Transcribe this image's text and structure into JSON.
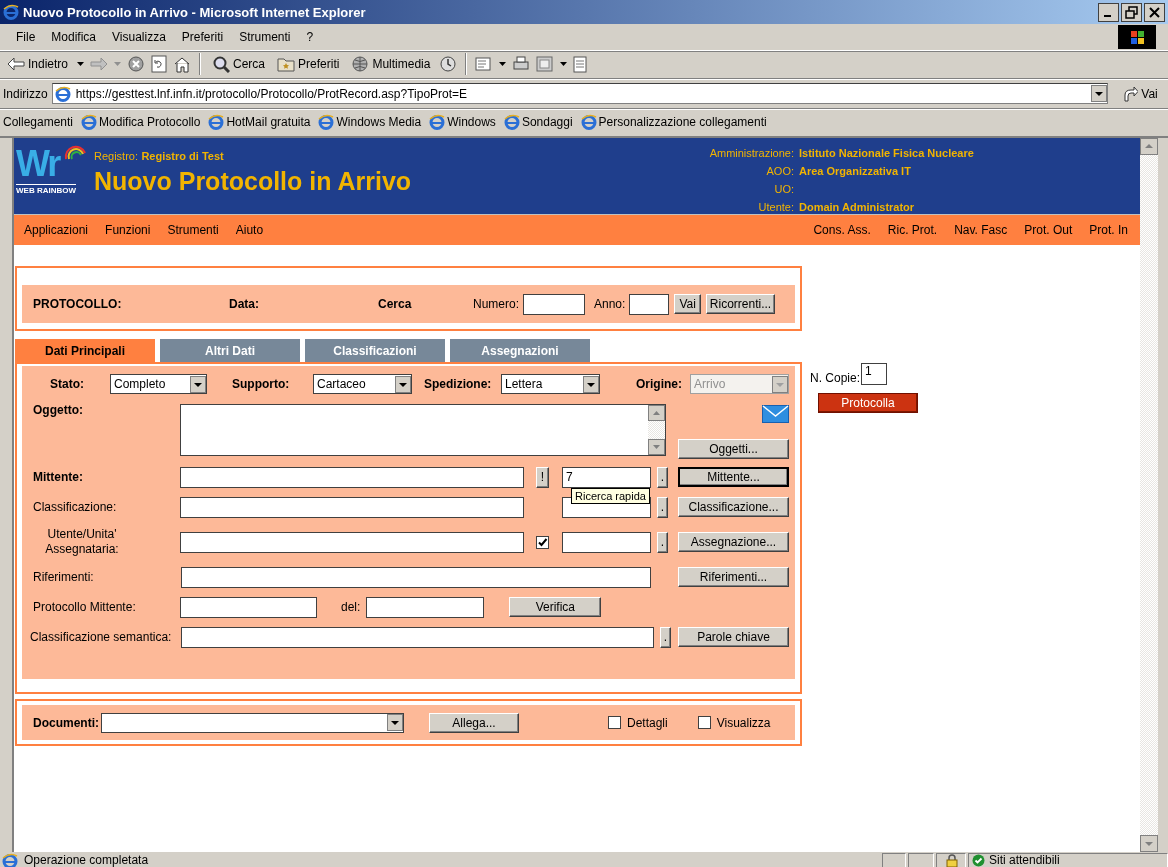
{
  "window": {
    "title": "Nuovo Protocollo in Arrivo - Microsoft Internet Explorer"
  },
  "menu_bar": [
    "File",
    "Modifica",
    "Visualizza",
    "Preferiti",
    "Strumenti",
    "?"
  ],
  "toolbar": {
    "back_label": "Indietro",
    "search_label": "Cerca",
    "favorites_label": "Preferiti",
    "media_label": "Multimedia"
  },
  "address_bar": {
    "label": "Indirizzo",
    "url": "https://gesttest.lnf.infn.it/protocollo/Protocollo/ProtRecord.asp?TipoProt=E",
    "go_label": "Vai"
  },
  "links_bar": {
    "label": "Collegamenti",
    "links": [
      "Modifica Protocollo",
      "HotMail gratuita",
      "Windows Media",
      "Windows",
      "Sondaggi",
      "Personalizzazione collegamenti"
    ]
  },
  "app_header": {
    "logo_mark": "Wr",
    "logo_caption": "WEB RAINBOW",
    "registry_label": "Registro:",
    "registry": "Registro di Test",
    "title": "Nuovo Protocollo in Arrivo",
    "info": [
      {
        "label": "Amministrazione:",
        "value": "Istituto Nazionale Fisica Nucleare"
      },
      {
        "label": "AOO:",
        "value": "Area Organizzativa IT"
      },
      {
        "label": "UO:"
      },
      {
        "label": "Utente:",
        "value": "Domain Administrator"
      }
    ]
  },
  "app_menu": {
    "left": [
      "Applicazioni",
      "Funzioni",
      "Strumenti",
      "Aiuto"
    ],
    "right": [
      "Cons. Ass.",
      "Ric. Prot.",
      "Nav. Fasc",
      "Prot. Out",
      "Prot. In"
    ]
  },
  "protocol_bar": {
    "protocol_label": "PROTOCOLLO:",
    "date_label": "Data:",
    "search_label": "Cerca",
    "number_label": "Numero:",
    "year_label": "Anno:",
    "go_button": "Vai",
    "recurring_button": "Ricorrenti..."
  },
  "tabs": [
    {
      "label": "Dati Principali",
      "selected": true
    },
    {
      "label": "Altri Dati",
      "selected": false
    },
    {
      "label": "Classificazioni",
      "selected": false
    },
    {
      "label": "Assegnazioni",
      "selected": false
    }
  ],
  "form": {
    "selects": [
      {
        "label": "Stato:",
        "value": "Completo",
        "disabled": false
      },
      {
        "label": "Supporto:",
        "value": "Cartaceo",
        "disabled": false
      },
      {
        "label": "Spedizione:",
        "value": "Lettera",
        "disabled": false
      },
      {
        "label": "Origine:",
        "value": "Arrivo",
        "disabled": true
      }
    ],
    "oggetto": {
      "label": "Oggetto:",
      "button": "Oggetti..."
    },
    "mittente": {
      "label": "Mittente:",
      "flag_button": "!",
      "code": "7",
      "dot_button": ".",
      "button": "Mittente..."
    },
    "classificazione": {
      "label": "Classificazione:",
      "dot_button": ".",
      "button": "Classificazione..."
    },
    "assegnataria": {
      "label": "Utente/Unita' Assegnataria:",
      "checked": true,
      "dot_button": ".",
      "button": "Assegnazione..."
    },
    "riferimenti": {
      "label": "Riferimenti:",
      "button": "Riferimenti..."
    },
    "protocollo_mittente": {
      "label": "Protocollo Mittente:",
      "date_label": "del:",
      "button": "Verifica"
    },
    "semantica": {
      "label": "Classificazione semantica:",
      "dot_button": ".",
      "button": "Parole chiave"
    }
  },
  "tooltip": {
    "text": "Ricerca rapida"
  },
  "side": {
    "copies_label": "N. Copie:",
    "copies": "1",
    "submit": "Protocolla"
  },
  "documents": {
    "label": "Documenti:",
    "button": "Allega...",
    "checkboxes": [
      {
        "label": "Dettagli",
        "checked": false
      },
      {
        "label": "Visualizza",
        "checked": false
      }
    ]
  },
  "status_bar": {
    "text": "Operazione completata",
    "zone": "Siti attendibili"
  }
}
